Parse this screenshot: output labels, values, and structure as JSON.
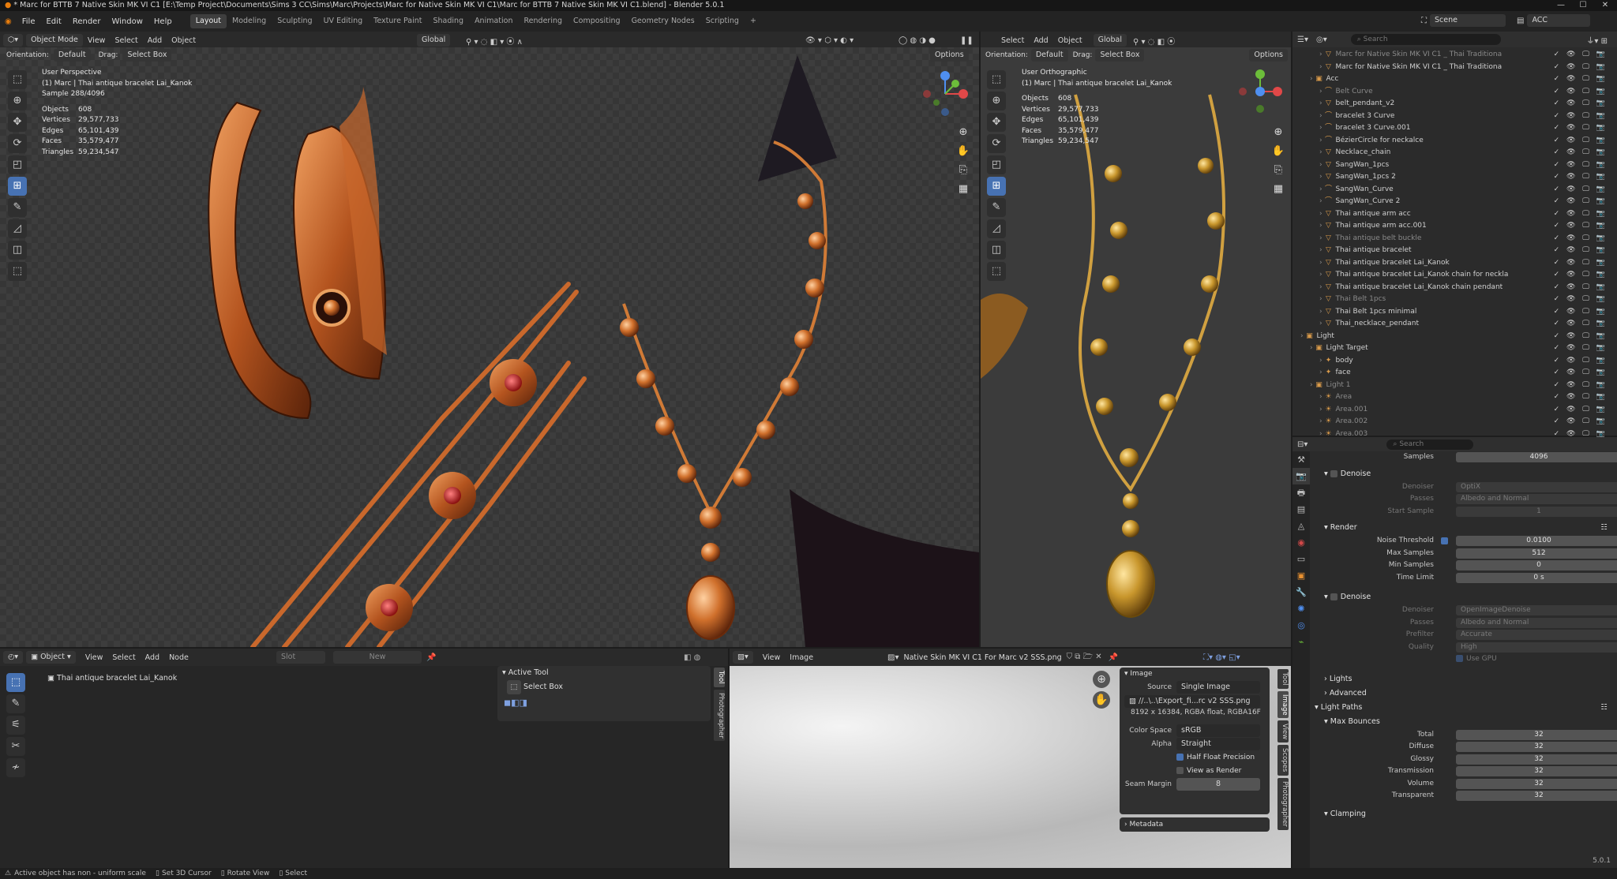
{
  "window": {
    "title": "* Marc for BTTB 7 Native Skin MK VI C1 [E:\\Temp Project\\Documents\\Sims 3 CC\\Sims\\Marc\\Projects\\Marc for Native Skin MK VI C1\\Marc for BTTB 7 Native Skin MK VI C1.blend] - Blender 5.0.1",
    "minimize": "—",
    "maximize": "☐",
    "close": "✕"
  },
  "menu": {
    "items": [
      "File",
      "Edit",
      "Render",
      "Window",
      "Help"
    ],
    "workspaces": [
      "Layout",
      "Modeling",
      "Sculpting",
      "UV Editing",
      "Texture Paint",
      "Shading",
      "Animation",
      "Rendering",
      "Compositing",
      "Geometry Nodes",
      "Scripting",
      "+"
    ],
    "active_workspace": "Layout",
    "scene_label": "Scene",
    "view_layer_label": "ACC"
  },
  "viewport_left": {
    "mode": "Object Mode",
    "menus": [
      "View",
      "Select",
      "Add",
      "Object"
    ],
    "transform_orientation": "Global",
    "orientation_label": "Orientation:",
    "orientation_value": "Default",
    "drag_label": "Drag:",
    "drag_value": "Select Box",
    "options": "Options",
    "overlay_title": "User Perspective",
    "overlay_object": "(1) Marc | Thai antique bracelet Lai_Kanok",
    "overlay_sample": "Sample 288/4096",
    "stats": [
      {
        "label": "Objects",
        "value": "608"
      },
      {
        "label": "Vertices",
        "value": "29,577,733"
      },
      {
        "label": "Edges",
        "value": "65,101,439"
      },
      {
        "label": "Faces",
        "value": "35,579,477"
      },
      {
        "label": "Triangles",
        "value": "59,234,547"
      }
    ]
  },
  "viewport_right": {
    "menus": [
      "Select",
      "Add",
      "Object"
    ],
    "transform_orientation": "Global",
    "orientation_label": "Orientation:",
    "orientation_value": "Default",
    "drag_label": "Drag:",
    "drag_value": "Select Box",
    "options": "Options",
    "overlay_title": "User Orthographic",
    "overlay_object": "(1) Marc | Thai antique bracelet Lai_Kanok",
    "stats": [
      {
        "label": "Objects",
        "value": "608"
      },
      {
        "label": "Vertices",
        "value": "29,577,733"
      },
      {
        "label": "Edges",
        "value": "65,101,439"
      },
      {
        "label": "Faces",
        "value": "35,579,477"
      },
      {
        "label": "Triangles",
        "value": "59,234,547"
      }
    ]
  },
  "outliner": {
    "search_placeholder": "Search",
    "rows": [
      {
        "indent": 2,
        "label": "Marc for Native Skin MK VI C1 _ Thai Traditiona",
        "dim": true,
        "icon": "▽"
      },
      {
        "indent": 2,
        "label": "Marc for Native Skin MK VI C1 _ Thai Traditiona",
        "dim": false,
        "icon": "▽"
      },
      {
        "indent": 1,
        "label": "Acc",
        "dim": false,
        "icon": "▣"
      },
      {
        "indent": 2,
        "label": "Belt Curve",
        "dim": true,
        "icon": "⌒"
      },
      {
        "indent": 2,
        "label": "belt_pendant_v2",
        "dim": false,
        "icon": "▽"
      },
      {
        "indent": 2,
        "label": "bracelet 3 Curve",
        "dim": false,
        "icon": "⌒"
      },
      {
        "indent": 2,
        "label": "bracelet 3 Curve.001",
        "dim": false,
        "icon": "⌒"
      },
      {
        "indent": 2,
        "label": "BézierCircle for neckalce",
        "dim": false,
        "icon": "⌒"
      },
      {
        "indent": 2,
        "label": "Necklace_chain",
        "dim": false,
        "icon": "▽"
      },
      {
        "indent": 2,
        "label": "SangWan_1pcs",
        "dim": false,
        "icon": "▽"
      },
      {
        "indent": 2,
        "label": "SangWan_1pcs 2",
        "dim": false,
        "icon": "▽"
      },
      {
        "indent": 2,
        "label": "SangWan_Curve",
        "dim": false,
        "icon": "⌒"
      },
      {
        "indent": 2,
        "label": "SangWan_Curve 2",
        "dim": false,
        "icon": "⌒"
      },
      {
        "indent": 2,
        "label": "Thai antique arm acc",
        "dim": false,
        "icon": "▽"
      },
      {
        "indent": 2,
        "label": "Thai antique arm acc.001",
        "dim": false,
        "icon": "▽"
      },
      {
        "indent": 2,
        "label": "Thai antique belt buckle",
        "dim": true,
        "icon": "▽"
      },
      {
        "indent": 2,
        "label": "Thai antique bracelet",
        "dim": false,
        "icon": "▽"
      },
      {
        "indent": 2,
        "label": "Thai antique bracelet Lai_Kanok",
        "dim": false,
        "icon": "▽"
      },
      {
        "indent": 2,
        "label": "Thai antique bracelet Lai_Kanok chain for neckla",
        "dim": false,
        "icon": "▽"
      },
      {
        "indent": 2,
        "label": "Thai antique bracelet Lai_Kanok chain pendant",
        "dim": false,
        "icon": "▽"
      },
      {
        "indent": 2,
        "label": "Thai Belt 1pcs",
        "dim": true,
        "icon": "▽"
      },
      {
        "indent": 2,
        "label": "Thai Belt 1pcs minimal",
        "dim": false,
        "icon": "▽"
      },
      {
        "indent": 2,
        "label": "Thai_necklace_pendant",
        "dim": false,
        "icon": "▽"
      },
      {
        "indent": 0,
        "label": "Light",
        "dim": false,
        "icon": "▣"
      },
      {
        "indent": 1,
        "label": "Light Target",
        "dim": false,
        "icon": "▣"
      },
      {
        "indent": 2,
        "label": "body",
        "dim": false,
        "icon": "✦"
      },
      {
        "indent": 2,
        "label": "face",
        "dim": false,
        "icon": "✦"
      },
      {
        "indent": 1,
        "label": "Light 1",
        "dim": true,
        "icon": "▣"
      },
      {
        "indent": 2,
        "label": "Area",
        "dim": true,
        "icon": "☀"
      },
      {
        "indent": 2,
        "label": "Area.001",
        "dim": true,
        "icon": "☀"
      },
      {
        "indent": 2,
        "label": "Area.002",
        "dim": true,
        "icon": "☀"
      },
      {
        "indent": 2,
        "label": "Area.003",
        "dim": true,
        "icon": "☀"
      }
    ]
  },
  "properties": {
    "search_placeholder": "Search",
    "samples_label": "Samples",
    "samples_value": "4096",
    "denoise1": {
      "header": "Denoise",
      "denoiser_label": "Denoiser",
      "denoiser": "OptiX",
      "passes_label": "Passes",
      "passes": "Albedo and Normal",
      "start_label": "Start Sample",
      "start": "1"
    },
    "render": {
      "header": "Render",
      "noise_label": "Noise Threshold",
      "noise": "0.0100",
      "max_label": "Max Samples",
      "max": "512",
      "min_label": "Min Samples",
      "min": "0",
      "time_label": "Time Limit",
      "time": "0 s"
    },
    "denoise2": {
      "header": "Denoise",
      "denoiser_label": "Denoiser",
      "denoiser": "OpenImageDenoise",
      "passes_label": "Passes",
      "passes": "Albedo and Normal",
      "prefilter_label": "Prefilter",
      "prefilter": "Accurate",
      "quality_label": "Quality",
      "quality": "High",
      "gpu": "Use GPU"
    },
    "lights": "Lights",
    "advanced": "Advanced",
    "light_paths": "Light Paths",
    "max_bounces": "Max Bounces",
    "bounces": [
      {
        "label": "Total",
        "value": "32"
      },
      {
        "label": "Diffuse",
        "value": "32"
      },
      {
        "label": "Glossy",
        "value": "32"
      },
      {
        "label": "Transmission",
        "value": "32"
      },
      {
        "label": "Volume",
        "value": "32"
      },
      {
        "label": "Transparent",
        "value": "32"
      }
    ],
    "clamping": "Clamping",
    "version": "5.0.1"
  },
  "node_editor": {
    "type": "Object",
    "menus": [
      "View",
      "Select",
      "Add",
      "Node"
    ],
    "slot": "Slot",
    "new": "New",
    "object_name": "Thai antique bracelet Lai_Kanok",
    "active_tool_header": "Active Tool",
    "active_tool": "Select Box",
    "side_tabs": [
      "Tool",
      "Photographer"
    ]
  },
  "image_editor": {
    "menus": [
      "View",
      "Image"
    ],
    "image_name": "Native Skin MK VI C1 For Marc v2 SSS.png",
    "panel_header": "Image",
    "source_label": "Source",
    "source": "Single Image",
    "filepath": "//..\\..\\Export_fi...rc v2 SSS.png",
    "info": "8192 x 16384,  RGBA float, RGBA16F",
    "colorspace_label": "Color Space",
    "colorspace": "sRGB",
    "alpha_label": "Alpha",
    "alpha": "Straight",
    "half_float": "Half Float Precision",
    "view_as_render": "View as Render",
    "seam_label": "Seam Margin",
    "seam": "8",
    "metadata": "Metadata",
    "side_tabs": [
      "Tool",
      "Image",
      "View",
      "Scopes",
      "Photographer"
    ]
  },
  "status": {
    "warning": "Active object has non - uniform scale",
    "hint1": "Set 3D Cursor",
    "hint2": "Rotate View",
    "hint3": "Select"
  }
}
